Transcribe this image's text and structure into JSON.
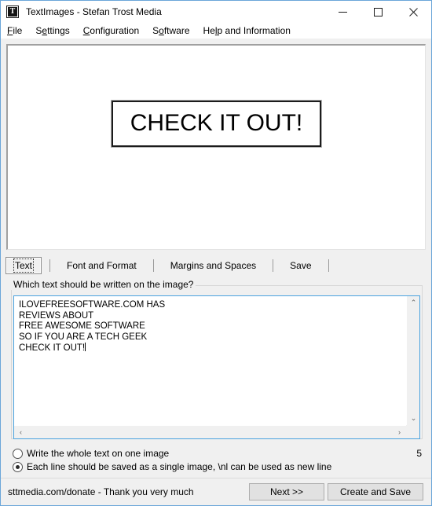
{
  "window": {
    "title": "TextImages - Stefan Trost Media",
    "icon": "app-text-icon",
    "controls": {
      "minimize": "minimize-icon",
      "maximize": "maximize-icon",
      "close": "close-icon"
    }
  },
  "menubar": {
    "items": [
      {
        "label": "File",
        "pre": "",
        "accel": "F",
        "post": "ile"
      },
      {
        "label": "Settings",
        "pre": "S",
        "accel": "e",
        "post": "ttings"
      },
      {
        "label": "Configuration",
        "pre": "",
        "accel": "C",
        "post": "onfiguration"
      },
      {
        "label": "Software",
        "pre": "S",
        "accel": "o",
        "post": "ftware"
      },
      {
        "label": "Help and Information",
        "pre": "He",
        "accel": "l",
        "post": "p and Information"
      }
    ]
  },
  "preview": {
    "image_text": "CHECK IT OUT!"
  },
  "tabs": [
    {
      "label": "Text",
      "selected": true
    },
    {
      "label": "Font and Format",
      "selected": false
    },
    {
      "label": "Margins and Spaces",
      "selected": false
    },
    {
      "label": "Save",
      "selected": false
    }
  ],
  "groupbox": {
    "label": "Which text should be written on the image?"
  },
  "editor": {
    "value": "ILOVEFREESOFTWARE.COM HAS\nREVIEWS ABOUT\nFREE AWESOME SOFTWARE\nSO IF YOU ARE A TECH GEEK\nCHECK IT OUT!",
    "scrollbars": {
      "up": "⌃",
      "down": "⌄",
      "left": "‹",
      "right": "›"
    }
  },
  "options": {
    "whole_text_label": "Write the whole text on one image",
    "whole_text_selected": false,
    "each_line_label": "Each line should be saved as a single image, \\nl can be used as new line",
    "each_line_selected": true,
    "line_count": "5"
  },
  "statusbar": {
    "text": "sttmedia.com/donate - Thank you very much",
    "next_label": "Next >>",
    "create_label": "Create and Save"
  },
  "colors": {
    "window_border": "#6ba6d9",
    "chrome": "#f0f0f0",
    "accent_focus": "#4aa3df",
    "button_face": "#e1e1e1"
  }
}
